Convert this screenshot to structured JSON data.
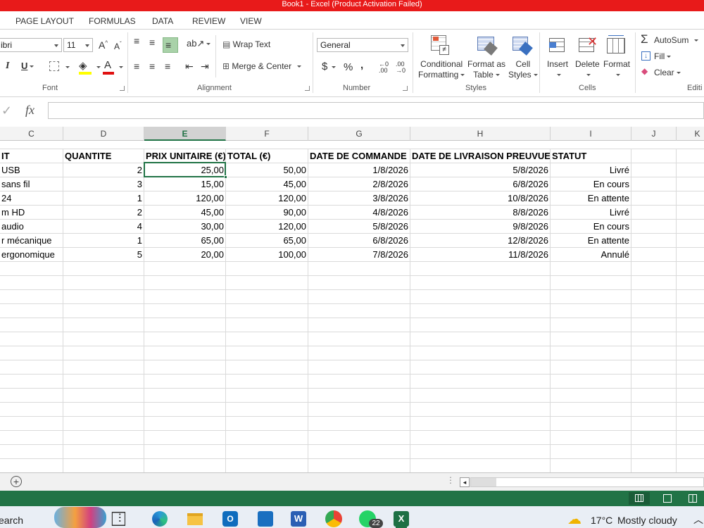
{
  "window": {
    "title": "Book1 -  Excel (Product Activation Failed)"
  },
  "tabs": [
    "PAGE LAYOUT",
    "FORMULAS",
    "DATA",
    "REVIEW",
    "VIEW"
  ],
  "ribbon": {
    "font_name": "ibri",
    "font_size": "11",
    "wrap_text": "Wrap Text",
    "merge_center": "Merge & Center",
    "number_format": "General",
    "conditional_formatting": [
      "Conditional",
      "Formatting"
    ],
    "format_as_table": [
      "Format as",
      "Table"
    ],
    "cell_styles": [
      "Cell",
      "Styles"
    ],
    "insert": "Insert",
    "delete": "Delete",
    "format": "Format",
    "autosum": "AutoSum",
    "fill": "Fill",
    "clear": "Clear",
    "groups": {
      "font": "Font",
      "alignment": "Alignment",
      "number": "Number",
      "styles": "Styles",
      "cells": "Cells",
      "editing": "Editi"
    }
  },
  "formula_bar": {
    "fx": "fx",
    "value": ""
  },
  "columns": [
    "C",
    "D",
    "E",
    "F",
    "G",
    "H",
    "I",
    "J",
    "K"
  ],
  "selected_column": "E",
  "table": {
    "headers": [
      "IT",
      "QUANTITE",
      "PRIX UNITAIRE (€)",
      "TOTAL (€)",
      "DATE DE COMMANDE",
      "DATE DE LIVRAISON PREUVUE",
      "STATUT"
    ],
    "rows": [
      [
        " USB",
        "2",
        "25,00",
        "50,00",
        "1/8/2026",
        "5/8/2026",
        "Livré"
      ],
      [
        "sans fil",
        "3",
        "15,00",
        "45,00",
        "2/8/2026",
        "6/8/2026",
        "En cours"
      ],
      [
        "24",
        "1",
        "120,00",
        "120,00",
        "3/8/2026",
        "10/8/2026",
        "En attente"
      ],
      [
        "m HD",
        "2",
        "45,00",
        "90,00",
        "4/8/2026",
        "8/8/2026",
        "Livré"
      ],
      [
        " audio",
        "4",
        "30,00",
        "120,00",
        "5/8/2026",
        "9/8/2026",
        "En cours"
      ],
      [
        "r mécanique",
        "1",
        "65,00",
        "65,00",
        "6/8/2026",
        "12/8/2026",
        "En attente"
      ],
      [
        "ergonomique",
        "5",
        "20,00",
        "100,00",
        "7/8/2026",
        "11/8/2026",
        "Annulé"
      ]
    ]
  },
  "taskbar": {
    "search": "earch",
    "whatsapp_badge": "22",
    "weather_temp": "17°C",
    "weather_desc": "Mostly cloudy"
  },
  "colors": {
    "excel_green": "#217346",
    "title_red": "#e81a1a"
  }
}
